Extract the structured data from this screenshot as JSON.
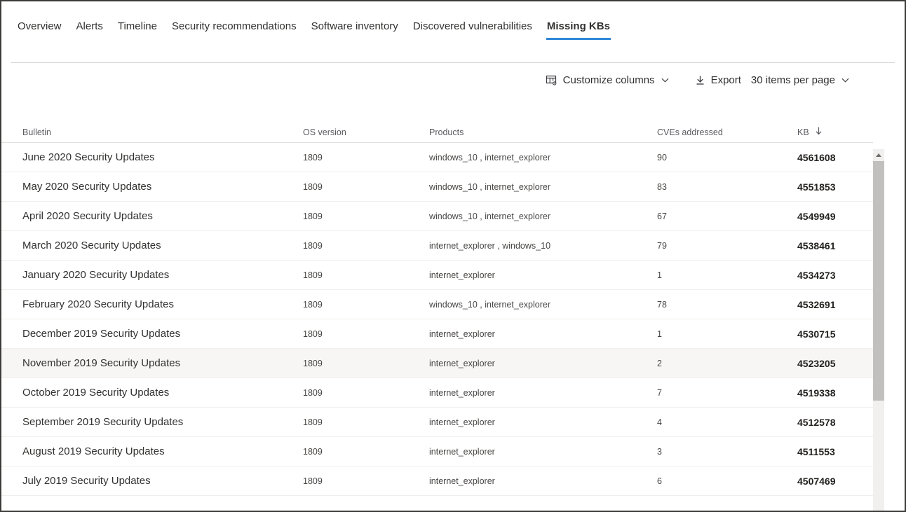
{
  "tabs": [
    {
      "label": "Overview",
      "active": false
    },
    {
      "label": "Alerts",
      "active": false
    },
    {
      "label": "Timeline",
      "active": false
    },
    {
      "label": "Security recommendations",
      "active": false
    },
    {
      "label": "Software inventory",
      "active": false
    },
    {
      "label": "Discovered vulnerabilities",
      "active": false
    },
    {
      "label": "Missing KBs",
      "active": true
    }
  ],
  "toolbar": {
    "customize_columns_label": "Customize columns",
    "export_label": "Export",
    "items_per_page_label": "30 items per page"
  },
  "accent_color": "#2e87d7",
  "table": {
    "columns": [
      {
        "key": "bulletin",
        "label": "Bulletin",
        "sorted": false
      },
      {
        "key": "os_version",
        "label": "OS version",
        "sorted": false
      },
      {
        "key": "products",
        "label": "Products",
        "sorted": false
      },
      {
        "key": "cves",
        "label": "CVEs addressed",
        "sorted": false
      },
      {
        "key": "kb",
        "label": "KB",
        "sorted": true,
        "sort_direction": "desc"
      }
    ],
    "product_separator": " ,  ",
    "rows": [
      {
        "bulletin": "June 2020 Security Updates",
        "os_version": "1809",
        "products": [
          "windows_10",
          "internet_explorer"
        ],
        "cves": "90",
        "kb": "4561608",
        "highlighted": false
      },
      {
        "bulletin": "May 2020 Security Updates",
        "os_version": "1809",
        "products": [
          "windows_10",
          "internet_explorer"
        ],
        "cves": "83",
        "kb": "4551853",
        "highlighted": false
      },
      {
        "bulletin": "April 2020 Security Updates",
        "os_version": "1809",
        "products": [
          "windows_10",
          "internet_explorer"
        ],
        "cves": "67",
        "kb": "4549949",
        "highlighted": false
      },
      {
        "bulletin": "March 2020 Security Updates",
        "os_version": "1809",
        "products": [
          "internet_explorer",
          "windows_10"
        ],
        "cves": "79",
        "kb": "4538461",
        "highlighted": false
      },
      {
        "bulletin": "January 2020 Security Updates",
        "os_version": "1809",
        "products": [
          "internet_explorer"
        ],
        "cves": "1",
        "kb": "4534273",
        "highlighted": false
      },
      {
        "bulletin": "February 2020 Security Updates",
        "os_version": "1809",
        "products": [
          "windows_10",
          "internet_explorer"
        ],
        "cves": "78",
        "kb": "4532691",
        "highlighted": false
      },
      {
        "bulletin": "December 2019 Security Updates",
        "os_version": "1809",
        "products": [
          "internet_explorer"
        ],
        "cves": "1",
        "kb": "4530715",
        "highlighted": false
      },
      {
        "bulletin": "November 2019 Security Updates",
        "os_version": "1809",
        "products": [
          "internet_explorer"
        ],
        "cves": "2",
        "kb": "4523205",
        "highlighted": true
      },
      {
        "bulletin": "October 2019 Security Updates",
        "os_version": "1809",
        "products": [
          "internet_explorer"
        ],
        "cves": "7",
        "kb": "4519338",
        "highlighted": false
      },
      {
        "bulletin": "September 2019 Security Updates",
        "os_version": "1809",
        "products": [
          "internet_explorer"
        ],
        "cves": "4",
        "kb": "4512578",
        "highlighted": false
      },
      {
        "bulletin": "August 2019 Security Updates",
        "os_version": "1809",
        "products": [
          "internet_explorer"
        ],
        "cves": "3",
        "kb": "4511553",
        "highlighted": false
      },
      {
        "bulletin": "July 2019 Security Updates",
        "os_version": "1809",
        "products": [
          "internet_explorer"
        ],
        "cves": "6",
        "kb": "4507469",
        "highlighted": false
      }
    ]
  }
}
